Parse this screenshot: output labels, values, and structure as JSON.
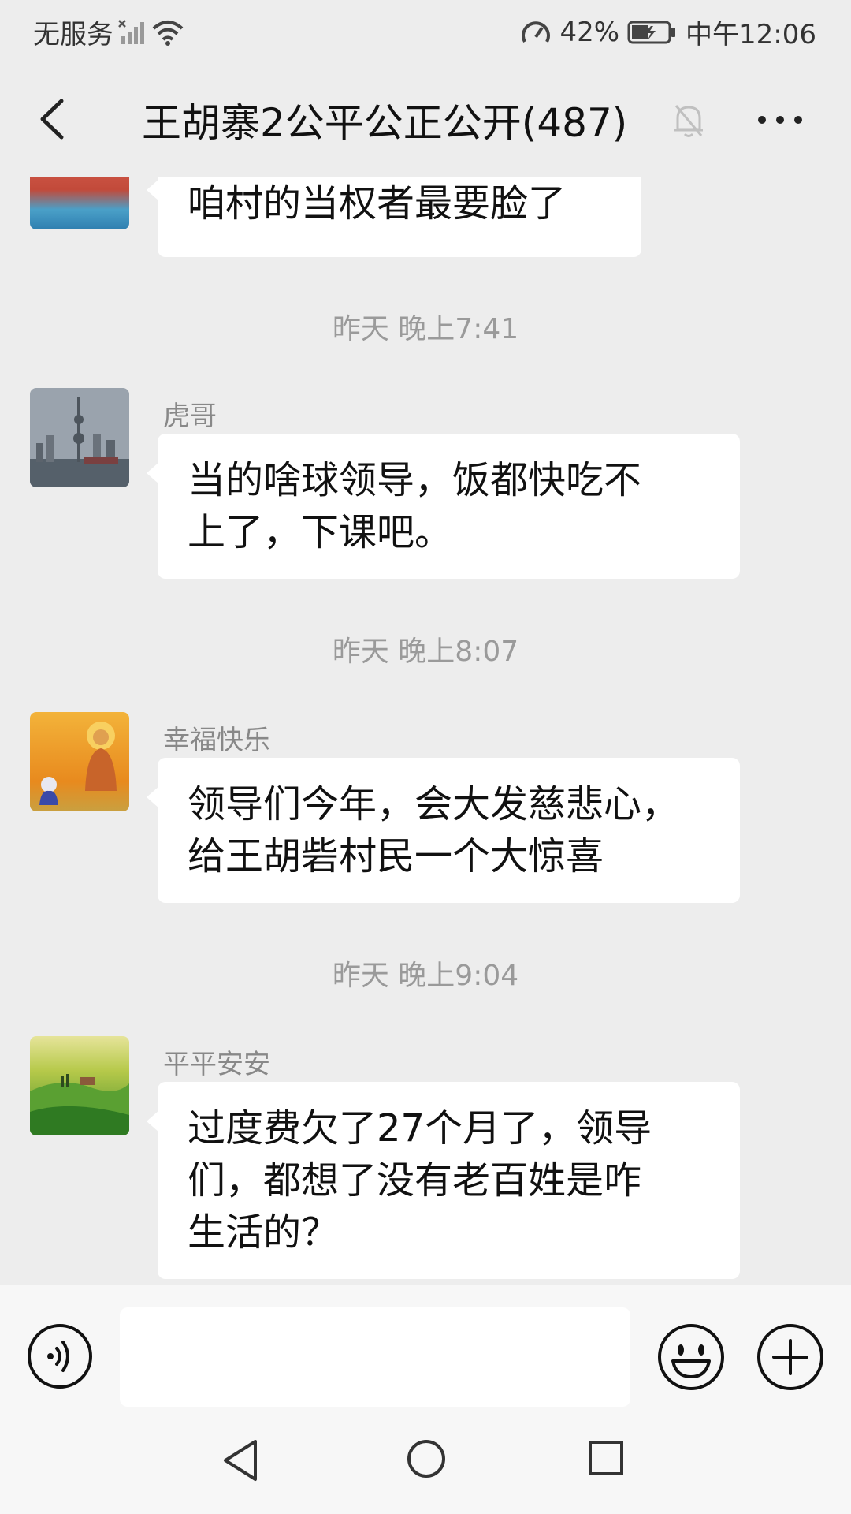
{
  "status_bar": {
    "carrier": "无服务",
    "battery": "42%",
    "time": "中午12:06"
  },
  "title_bar": {
    "title": "王胡寨2公平公正公开(487)"
  },
  "messages": [
    {
      "type": "text",
      "sender": "",
      "text": "咱村的当权者最要脸了"
    },
    {
      "type": "time",
      "text": "昨天 晚上7:41"
    },
    {
      "type": "text",
      "sender": "虎哥",
      "lines": [
        "当的啥球领导，饭都快吃不",
        "上了，下课吧。"
      ]
    },
    {
      "type": "time",
      "text": "昨天 晚上8:07"
    },
    {
      "type": "text",
      "sender": "幸福快乐",
      "lines": [
        "领导们今年，会大发慈悲心，",
        "给王胡砦村民一个大惊喜"
      ]
    },
    {
      "type": "time",
      "text": "昨天 晚上9:04"
    },
    {
      "type": "text",
      "sender": "平平安安",
      "lines": [
        "过度费欠了27个月了，领导",
        "们，都想了没有老百姓是咋",
        "生活的？"
      ]
    }
  ],
  "colors": {
    "background": "#ededed",
    "bubble": "#ffffff",
    "timestamp": "#9a9a9a"
  }
}
